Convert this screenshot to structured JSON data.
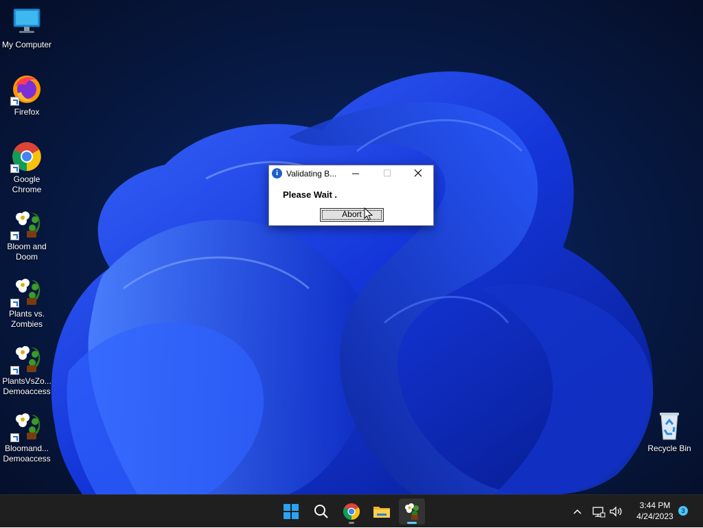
{
  "desktop": {
    "icons": [
      {
        "label": "My Computer"
      },
      {
        "label": "Firefox"
      },
      {
        "label": "Google Chrome"
      },
      {
        "label": "Bloom and Doom"
      },
      {
        "label": "Plants vs. Zombies"
      },
      {
        "label": "PlantsVsZo... Demoaccess"
      },
      {
        "label": "Bloomand... Demoaccess"
      },
      {
        "label": "Recycle Bin"
      }
    ]
  },
  "dialog": {
    "title": "Validating B...",
    "message": "Please Wait .",
    "abort_label": "Abort"
  },
  "taskbar": {
    "time": "3:44 PM",
    "date": "4/24/2023",
    "notification_count": "3"
  },
  "colors": {
    "accent": "#0078d4",
    "taskbar_bg": "#1f1f1f",
    "active_indicator": "#60cdff"
  }
}
